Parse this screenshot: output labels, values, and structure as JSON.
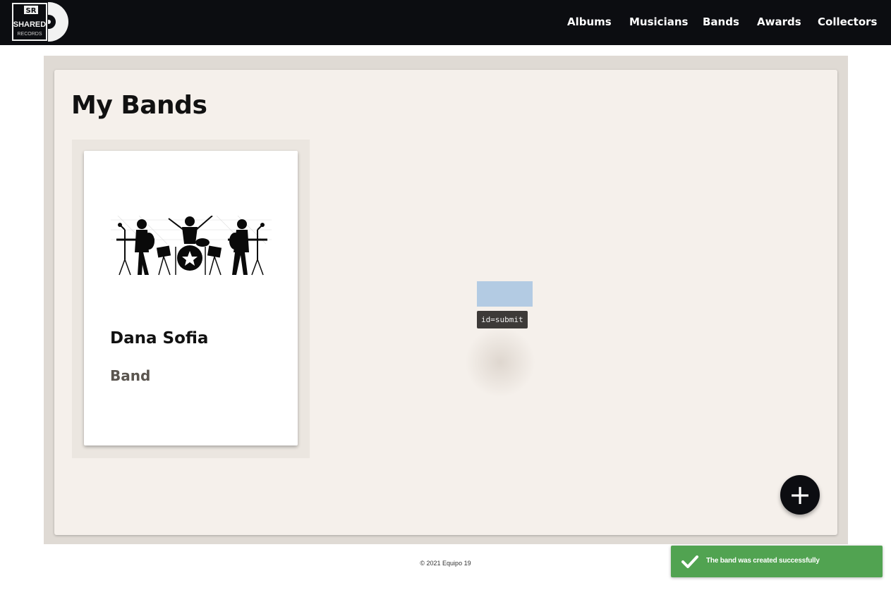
{
  "header": {
    "logo": {
      "text_top": "SR",
      "text_main": "SHARED",
      "text_sub": "RECORDS",
      "icon": "vinyl-record-logo"
    },
    "nav": [
      {
        "label": "Albums"
      },
      {
        "label": "Musicians"
      },
      {
        "label": "Bands"
      },
      {
        "label": "Awards"
      },
      {
        "label": "Collectors"
      }
    ]
  },
  "main": {
    "title": "My Bands",
    "cards": [
      {
        "name": "Dana Sofia",
        "type": "Band",
        "image": "band-silhouette-illustration"
      }
    ],
    "add_button": {
      "icon": "plus-icon",
      "symbol": "+"
    }
  },
  "overlay": {
    "element_label": "id=submit"
  },
  "footer": {
    "text": "© 2021 Equipo 19"
  },
  "toast": {
    "message": "The band was created successfully",
    "icon": "checkmark-icon",
    "color": "#51a351"
  },
  "colors": {
    "header_bg": "#0c0d11",
    "panel_bg": "#f5f0eb",
    "outer_bg": "#dfdad4",
    "accent": "#0c0d11"
  }
}
